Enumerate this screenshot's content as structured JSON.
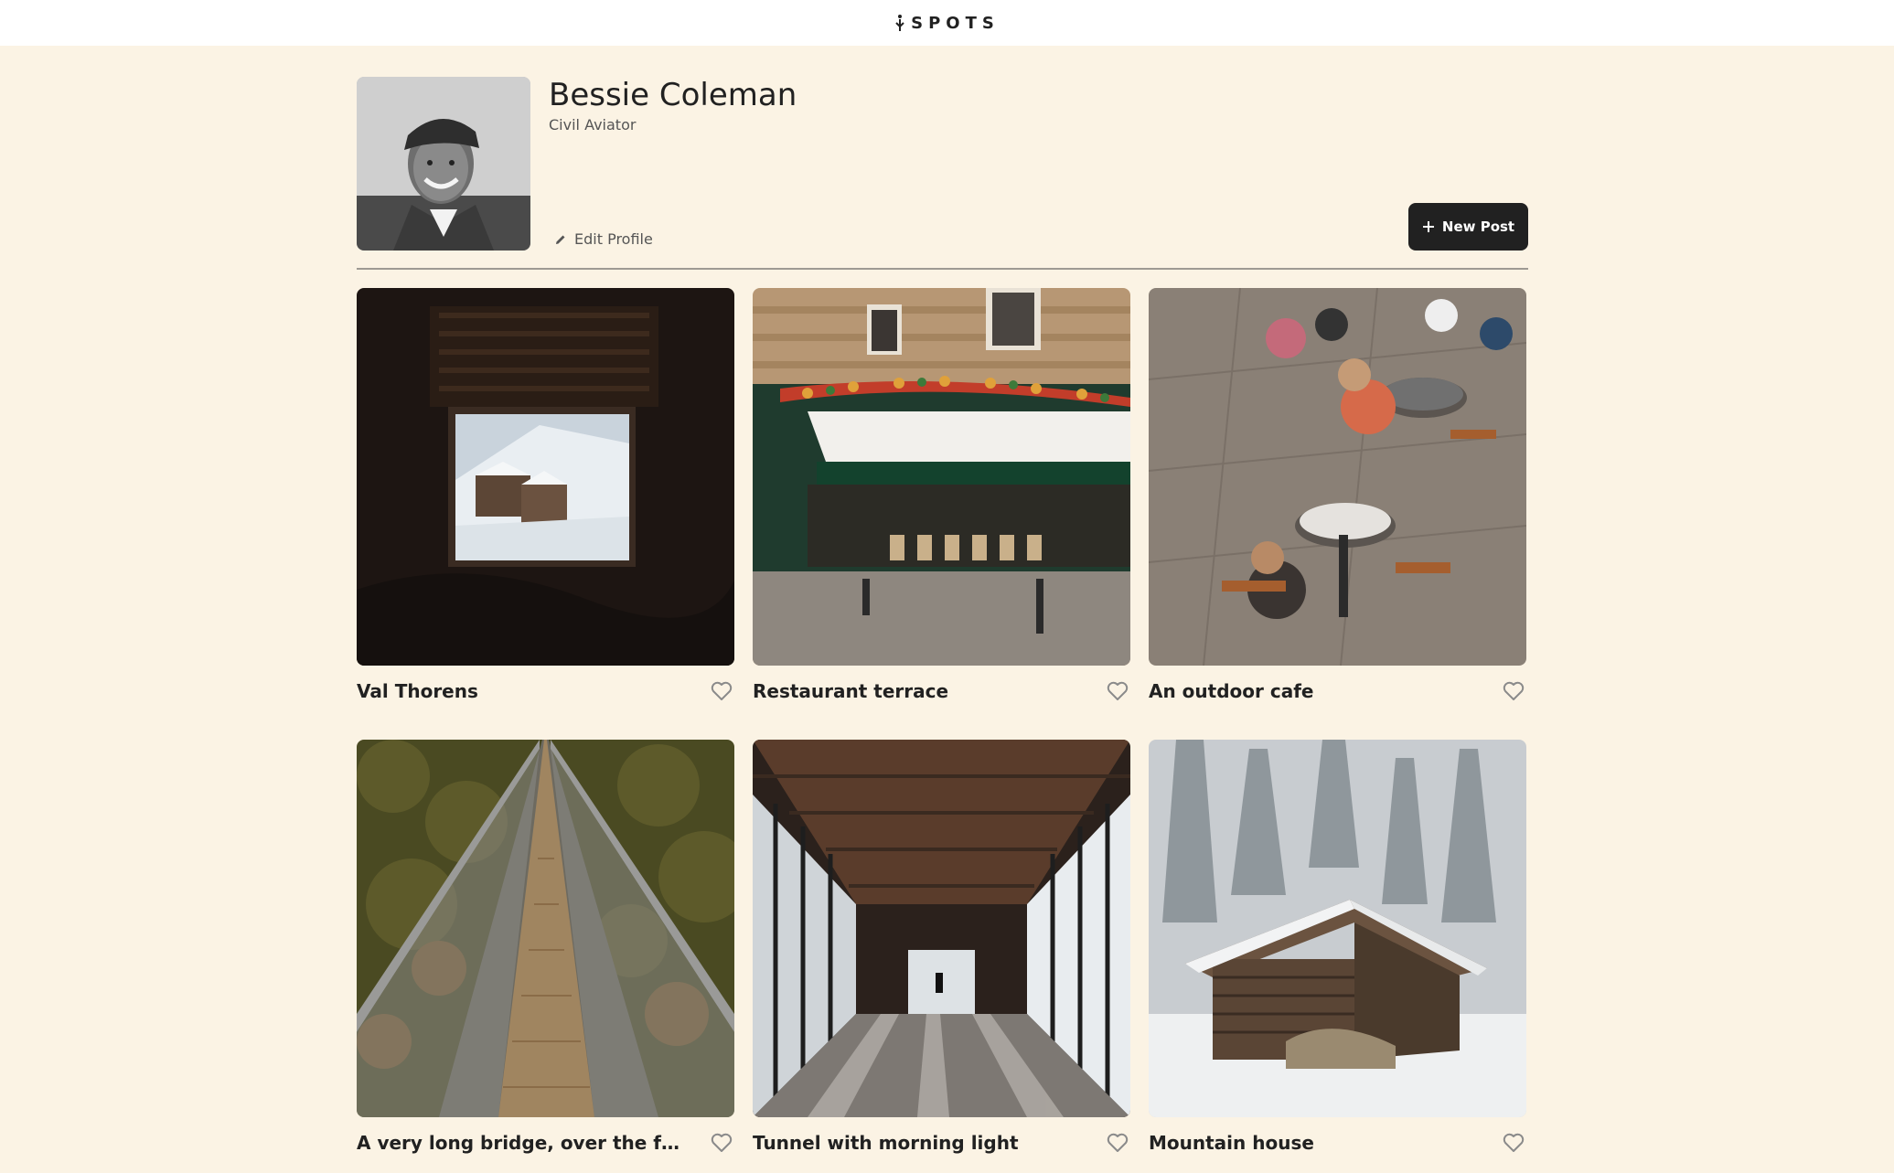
{
  "header": {
    "logo_text": "SPOTS"
  },
  "profile": {
    "name": "Bessie Coleman",
    "description": "Civil Aviator",
    "edit_label": "Edit Profile",
    "new_post_label": "New Post"
  },
  "colors": {
    "page_background": "#fbf3e4",
    "header_background": "#ffffff",
    "text_primary": "#212121",
    "text_secondary": "#555555",
    "button_background": "#212121"
  },
  "cards": [
    {
      "title": "Val Thorens",
      "image": "window with snowy village view",
      "liked": false
    },
    {
      "title": "Restaurant terrace",
      "image": "restaurant storefront with green awning",
      "liked": false
    },
    {
      "title": "An outdoor cafe",
      "image": "people at outdoor cafe tables",
      "liked": false
    },
    {
      "title": "A very long bridge, over the forest...",
      "image": "suspension bridge over forest",
      "liked": false
    },
    {
      "title": "Tunnel with morning light",
      "image": "glass-walled covered walkway",
      "liked": false
    },
    {
      "title": "Mountain house",
      "image": "wooden cabin in snowy forest",
      "liked": false
    }
  ]
}
